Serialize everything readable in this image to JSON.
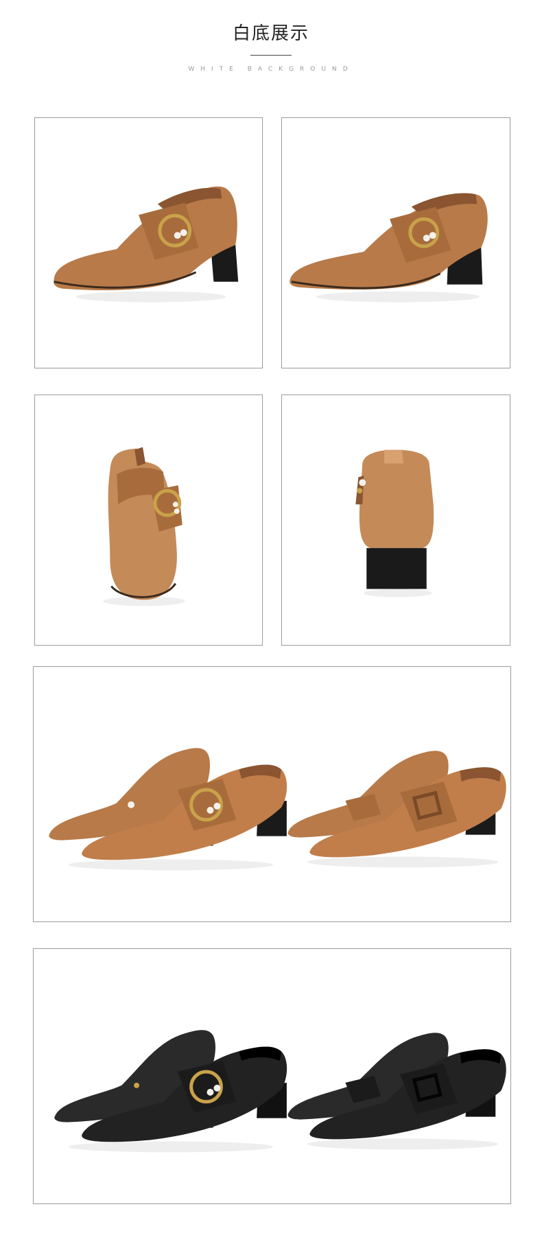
{
  "header": {
    "title": "白底展示",
    "subtitle": "WHITE BACKGROUND"
  },
  "panels": [
    {
      "view": "side-view-tan-pearl-buckle"
    },
    {
      "view": "side-view-tan-pearl-buckle-alt"
    },
    {
      "view": "front-view-tan"
    },
    {
      "view": "back-view-tan-heel"
    },
    {
      "view": "pair-views-tan"
    },
    {
      "view": "pair-views-black"
    }
  ],
  "colors": {
    "tan": "#b87a48",
    "tan_dark": "#8a5530",
    "black_leather": "#222222",
    "heel": "#1a1a1a",
    "buckle_gold": "#c9a24a",
    "pearl": "#f4f1ea"
  }
}
